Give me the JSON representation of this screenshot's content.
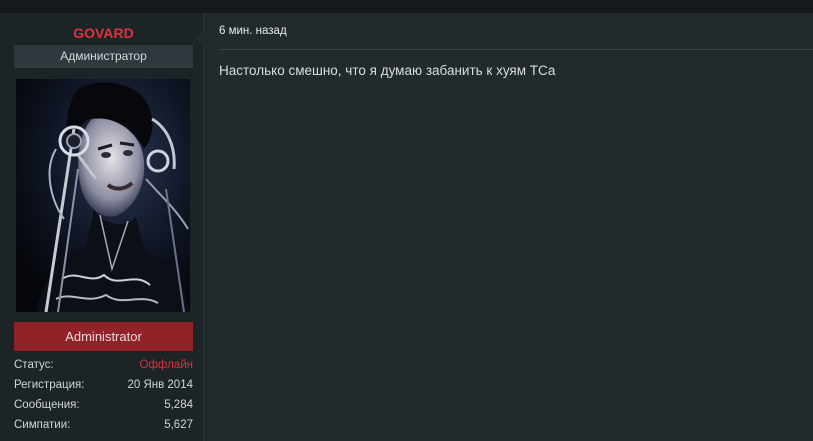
{
  "user": {
    "name": "GOVARD",
    "title": "Администратор",
    "group": "Administrator",
    "stats": [
      {
        "label": "Статус:",
        "value": "Оффлайн"
      },
      {
        "label": "Регистрация:",
        "value": "20 Янв 2014"
      },
      {
        "label": "Сообщения:",
        "value": "5,284"
      },
      {
        "label": "Симпатии:",
        "value": "5,627"
      }
    ]
  },
  "post": {
    "time": "6 мин. назад",
    "message": "Настолько смешно, что я думаю забанить к хуям ТСа"
  },
  "colors": {
    "username": "#e0323a",
    "group_bar": "#8f2328",
    "offline": "#d8323a",
    "background": "#1b2124"
  },
  "icons": {
    "avatar": "user-avatar-photo"
  }
}
